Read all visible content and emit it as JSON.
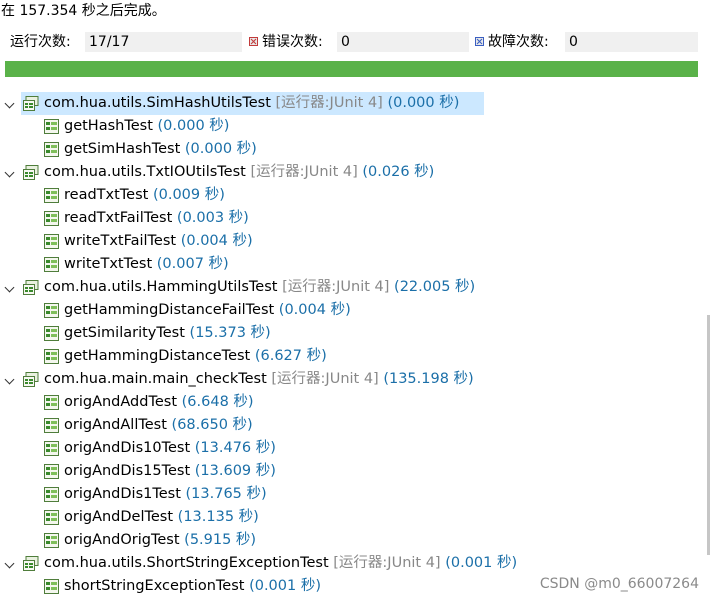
{
  "status": {
    "text": "在 157.354 秒之后完成。"
  },
  "counters": {
    "runs_label": "运行次数:",
    "runs_value": "17/17",
    "errors_label": "错误次数:",
    "errors_value": "0",
    "failures_label": "故障次数:",
    "failures_value": "0"
  },
  "progress": {
    "fraction": 1.0,
    "color": "#5ab249"
  },
  "tree": {
    "suites": [
      {
        "name": "com.hua.utils.SimHashUtilsTest",
        "runner": "[运行器:JUnit 4]",
        "time": "(0.000 秒)",
        "tests": [
          {
            "name": "getHashTest",
            "time": "(0.000 秒)"
          },
          {
            "name": "getSimHashTest",
            "time": "(0.000 秒)"
          }
        ]
      },
      {
        "name": "com.hua.utils.TxtIOUtilsTest",
        "runner": "[运行器:JUnit 4]",
        "time": "(0.026 秒)",
        "tests": [
          {
            "name": "readTxtTest",
            "time": "(0.009 秒)"
          },
          {
            "name": "readTxtFailTest",
            "time": "(0.003 秒)"
          },
          {
            "name": "writeTxtFailTest",
            "time": "(0.004 秒)"
          },
          {
            "name": "writeTxtTest",
            "time": "(0.007 秒)"
          }
        ]
      },
      {
        "name": "com.hua.utils.HammingUtilsTest",
        "runner": "[运行器:JUnit 4]",
        "time": "(22.005 秒)",
        "tests": [
          {
            "name": "getHammingDistanceFailTest",
            "time": "(0.004 秒)"
          },
          {
            "name": "getSimilarityTest",
            "time": "(15.373 秒)"
          },
          {
            "name": "getHammingDistanceTest",
            "time": "(6.627 秒)"
          }
        ]
      },
      {
        "name": "com.hua.main.main_checkTest",
        "runner": "[运行器:JUnit 4]",
        "time": "(135.198 秒)",
        "tests": [
          {
            "name": "origAndAddTest",
            "time": "(6.648 秒)"
          },
          {
            "name": "origAndAllTest",
            "time": "(68.650 秒)"
          },
          {
            "name": "origAndDis10Test",
            "time": "(13.476 秒)"
          },
          {
            "name": "origAndDis15Test",
            "time": "(13.609 秒)"
          },
          {
            "name": "origAndDis1Test",
            "time": "(13.765 秒)"
          },
          {
            "name": "origAndDelTest",
            "time": "(13.135 秒)"
          },
          {
            "name": "origAndOrigTest",
            "time": "(5.915 秒)"
          }
        ]
      },
      {
        "name": "com.hua.utils.ShortStringExceptionTest",
        "runner": "[运行器:JUnit 4]",
        "time": "(0.001 秒)",
        "tests": [
          {
            "name": "shortStringExceptionTest",
            "time": "(0.001 秒)"
          }
        ]
      }
    ]
  },
  "watermark": "CSDN @m0_66007264",
  "icons": {
    "suite": "test-suite-pass-icon",
    "case": "test-case-pass-icon",
    "expand": "chevron-down-icon"
  }
}
